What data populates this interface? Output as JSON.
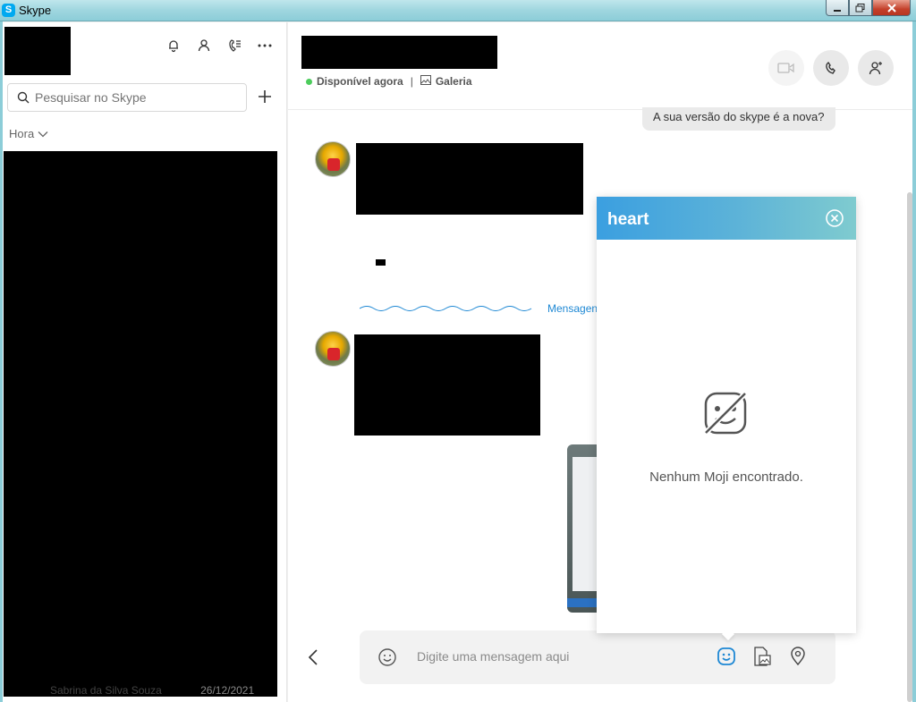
{
  "window": {
    "title": "Skype",
    "app_icon": "S"
  },
  "sidebar": {
    "search": {
      "placeholder": "Pesquisar no Skype"
    },
    "sort_label": "Hora",
    "last_contact": {
      "name": "Sabrina da Silva Souza",
      "date": "26/12/2021"
    },
    "icons": [
      "bell-icon",
      "contacts-icon",
      "calls-icon",
      "more-icon"
    ]
  },
  "chat": {
    "status": "Disponível agora",
    "separator": "|",
    "gallery": "Galeria",
    "messages": {
      "outgoing_text": "A sua versão do skype é a nova?",
      "new_messages_label": "Mensagen"
    },
    "composer": {
      "placeholder": "Digite uma mensagem aqui"
    }
  },
  "moji_panel": {
    "title": "heart",
    "empty_message": "Nenhum Moji encontrado."
  },
  "colors": {
    "accent": "#1e88d4",
    "status_online": "#4ccc5c",
    "panel_gradient_start": "#3b9fe0",
    "panel_gradient_end": "#7fcbcf"
  }
}
